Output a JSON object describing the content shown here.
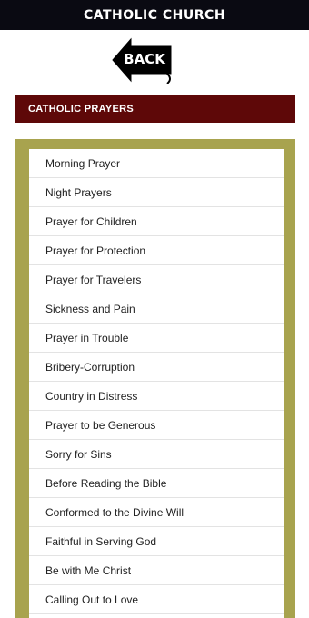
{
  "header": {
    "title": "CATHOLIC CHURCH"
  },
  "back": {
    "label": "BACK"
  },
  "section": {
    "title": "CATHOLIC PRAYERS"
  },
  "colors": {
    "titlebar": "#0a0a12",
    "section_header": "#5e0808",
    "list_frame": "#a8a34e"
  },
  "prayers": [
    "Morning Prayer",
    "Night Prayers",
    "Prayer for Children",
    "Prayer for Protection",
    "Prayer for Travelers",
    "Sickness and Pain",
    "Prayer in Trouble",
    "Bribery-Corruption",
    "Country in Distress",
    "Prayer to be Generous",
    "Sorry for Sins",
    "Before Reading the Bible",
    "Conformed to the Divine Will",
    "Faithful in Serving God",
    "Be with Me Christ",
    "Calling Out to Love"
  ]
}
